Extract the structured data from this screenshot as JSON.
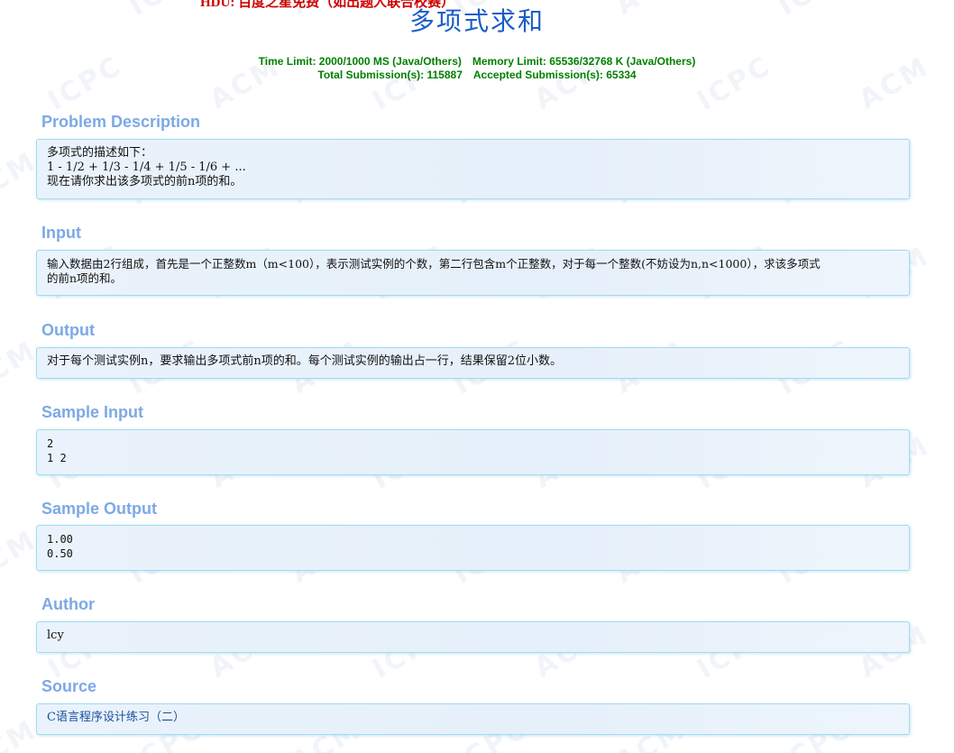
{
  "header": {
    "notice": "HDU: 百度之星免费（如出题人联合校赛）",
    "title": "多项式求和",
    "time_limit": "Time Limit: 2000/1000 MS (Java/Others)",
    "memory_limit": "Memory Limit: 65536/32768 K (Java/Others)",
    "total_submissions": "Total Submission(s): 115887",
    "accepted_submissions": "Accepted Submission(s): 65334"
  },
  "watermark": {
    "word_a": "ACM",
    "word_b": "ICPC"
  },
  "sections": {
    "description": {
      "heading": "Problem Description",
      "lines": [
        "多项式的描述如下：",
        "1 - 1/2 + 1/3 - 1/4 + 1/5 - 1/6 + ...",
        "现在请你求出该多项式的前n项的和。"
      ]
    },
    "input": {
      "heading": "Input",
      "lines": [
        "输入数据由2行组成，首先是一个正整数m（m<100），表示测试实例的个数，第二行包含m个正整数，对于每一个整数(不妨设为n,n<1000），求该多项式",
        "的前n项的和。"
      ]
    },
    "output": {
      "heading": "Output",
      "lines": [
        "对于每个测试实例n，要求输出多项式前n项的和。每个测试实例的输出占一行，结果保留2位小数。"
      ]
    },
    "sample_input": {
      "heading": "Sample Input",
      "lines": [
        "2",
        "1 2"
      ]
    },
    "sample_output": {
      "heading": "Sample Output",
      "lines": [
        "1.00",
        "0.50"
      ]
    },
    "author": {
      "heading": "Author",
      "lines": [
        "lcy"
      ]
    },
    "source": {
      "heading": "Source",
      "link_text": "C语言程序设计练习（二）"
    }
  },
  "colors": {
    "title": "#1a5cc8",
    "limits": "#008000",
    "section_heading": "#7ca9e6",
    "panel_border": "#9ddcf0",
    "notice": "#cc0000"
  }
}
